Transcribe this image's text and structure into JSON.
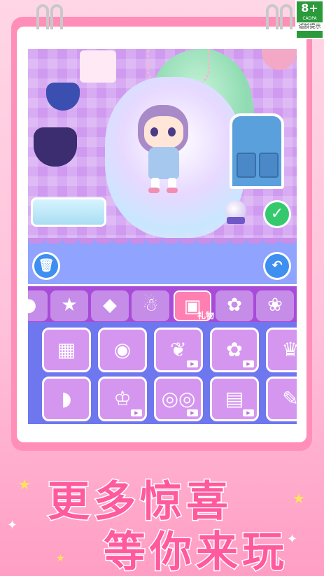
{
  "rating": {
    "age": "8+",
    "code": "CADPA",
    "tip": "适龄提示"
  },
  "tabs": [
    {
      "name": "bubble",
      "icon": "●"
    },
    {
      "name": "star",
      "icon": "★"
    },
    {
      "name": "diamond",
      "icon": "◆"
    },
    {
      "name": "ghost",
      "icon": "☃"
    },
    {
      "name": "gift",
      "icon": "▣",
      "label": "礼物"
    },
    {
      "name": "bunny",
      "icon": "✿"
    },
    {
      "name": "flower",
      "icon": "❀"
    }
  ],
  "items_row1": [
    "▦",
    "◉",
    "❦",
    "✿",
    "♛"
  ],
  "items_row2": [
    "◗",
    "♔",
    "◎◎",
    "▤",
    "✎"
  ],
  "buttons": {
    "trash": "🗑",
    "undo": "↶",
    "confirm": "✓"
  },
  "headline": {
    "line1": "更多惊喜",
    "line2": "等你来玩"
  },
  "colors": {
    "accent": "#ff5a9e",
    "room": "#cf9af0",
    "tabbar": "#a84bd8",
    "grid": "#6f77ef",
    "toolbar": "#8fa3ff"
  }
}
